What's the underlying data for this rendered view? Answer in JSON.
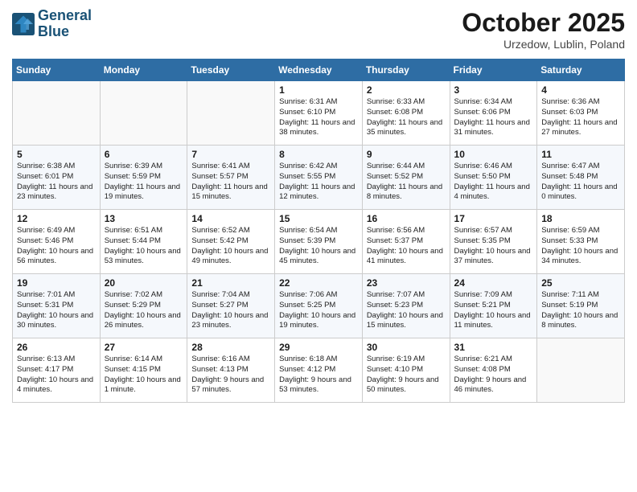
{
  "header": {
    "logo_line1": "General",
    "logo_line2": "Blue",
    "month": "October 2025",
    "location": "Urzedow, Lublin, Poland"
  },
  "weekdays": [
    "Sunday",
    "Monday",
    "Tuesday",
    "Wednesday",
    "Thursday",
    "Friday",
    "Saturday"
  ],
  "weeks": [
    [
      {
        "day": "",
        "info": ""
      },
      {
        "day": "",
        "info": ""
      },
      {
        "day": "",
        "info": ""
      },
      {
        "day": "1",
        "info": "Sunrise: 6:31 AM\nSunset: 6:10 PM\nDaylight: 11 hours\nand 38 minutes."
      },
      {
        "day": "2",
        "info": "Sunrise: 6:33 AM\nSunset: 6:08 PM\nDaylight: 11 hours\nand 35 minutes."
      },
      {
        "day": "3",
        "info": "Sunrise: 6:34 AM\nSunset: 6:06 PM\nDaylight: 11 hours\nand 31 minutes."
      },
      {
        "day": "4",
        "info": "Sunrise: 6:36 AM\nSunset: 6:03 PM\nDaylight: 11 hours\nand 27 minutes."
      }
    ],
    [
      {
        "day": "5",
        "info": "Sunrise: 6:38 AM\nSunset: 6:01 PM\nDaylight: 11 hours\nand 23 minutes."
      },
      {
        "day": "6",
        "info": "Sunrise: 6:39 AM\nSunset: 5:59 PM\nDaylight: 11 hours\nand 19 minutes."
      },
      {
        "day": "7",
        "info": "Sunrise: 6:41 AM\nSunset: 5:57 PM\nDaylight: 11 hours\nand 15 minutes."
      },
      {
        "day": "8",
        "info": "Sunrise: 6:42 AM\nSunset: 5:55 PM\nDaylight: 11 hours\nand 12 minutes."
      },
      {
        "day": "9",
        "info": "Sunrise: 6:44 AM\nSunset: 5:52 PM\nDaylight: 11 hours\nand 8 minutes."
      },
      {
        "day": "10",
        "info": "Sunrise: 6:46 AM\nSunset: 5:50 PM\nDaylight: 11 hours\nand 4 minutes."
      },
      {
        "day": "11",
        "info": "Sunrise: 6:47 AM\nSunset: 5:48 PM\nDaylight: 11 hours\nand 0 minutes."
      }
    ],
    [
      {
        "day": "12",
        "info": "Sunrise: 6:49 AM\nSunset: 5:46 PM\nDaylight: 10 hours\nand 56 minutes."
      },
      {
        "day": "13",
        "info": "Sunrise: 6:51 AM\nSunset: 5:44 PM\nDaylight: 10 hours\nand 53 minutes."
      },
      {
        "day": "14",
        "info": "Sunrise: 6:52 AM\nSunset: 5:42 PM\nDaylight: 10 hours\nand 49 minutes."
      },
      {
        "day": "15",
        "info": "Sunrise: 6:54 AM\nSunset: 5:39 PM\nDaylight: 10 hours\nand 45 minutes."
      },
      {
        "day": "16",
        "info": "Sunrise: 6:56 AM\nSunset: 5:37 PM\nDaylight: 10 hours\nand 41 minutes."
      },
      {
        "day": "17",
        "info": "Sunrise: 6:57 AM\nSunset: 5:35 PM\nDaylight: 10 hours\nand 37 minutes."
      },
      {
        "day": "18",
        "info": "Sunrise: 6:59 AM\nSunset: 5:33 PM\nDaylight: 10 hours\nand 34 minutes."
      }
    ],
    [
      {
        "day": "19",
        "info": "Sunrise: 7:01 AM\nSunset: 5:31 PM\nDaylight: 10 hours\nand 30 minutes."
      },
      {
        "day": "20",
        "info": "Sunrise: 7:02 AM\nSunset: 5:29 PM\nDaylight: 10 hours\nand 26 minutes."
      },
      {
        "day": "21",
        "info": "Sunrise: 7:04 AM\nSunset: 5:27 PM\nDaylight: 10 hours\nand 23 minutes."
      },
      {
        "day": "22",
        "info": "Sunrise: 7:06 AM\nSunset: 5:25 PM\nDaylight: 10 hours\nand 19 minutes."
      },
      {
        "day": "23",
        "info": "Sunrise: 7:07 AM\nSunset: 5:23 PM\nDaylight: 10 hours\nand 15 minutes."
      },
      {
        "day": "24",
        "info": "Sunrise: 7:09 AM\nSunset: 5:21 PM\nDaylight: 10 hours\nand 11 minutes."
      },
      {
        "day": "25",
        "info": "Sunrise: 7:11 AM\nSunset: 5:19 PM\nDaylight: 10 hours\nand 8 minutes."
      }
    ],
    [
      {
        "day": "26",
        "info": "Sunrise: 6:13 AM\nSunset: 4:17 PM\nDaylight: 10 hours\nand 4 minutes."
      },
      {
        "day": "27",
        "info": "Sunrise: 6:14 AM\nSunset: 4:15 PM\nDaylight: 10 hours\nand 1 minute."
      },
      {
        "day": "28",
        "info": "Sunrise: 6:16 AM\nSunset: 4:13 PM\nDaylight: 9 hours\nand 57 minutes."
      },
      {
        "day": "29",
        "info": "Sunrise: 6:18 AM\nSunset: 4:12 PM\nDaylight: 9 hours\nand 53 minutes."
      },
      {
        "day": "30",
        "info": "Sunrise: 6:19 AM\nSunset: 4:10 PM\nDaylight: 9 hours\nand 50 minutes."
      },
      {
        "day": "31",
        "info": "Sunrise: 6:21 AM\nSunset: 4:08 PM\nDaylight: 9 hours\nand 46 minutes."
      },
      {
        "day": "",
        "info": ""
      }
    ]
  ]
}
